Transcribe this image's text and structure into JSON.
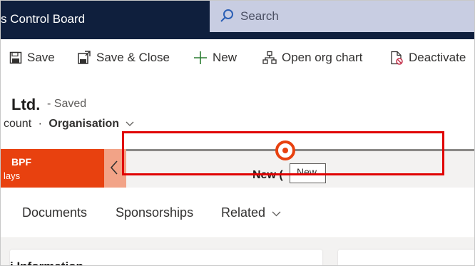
{
  "app": {
    "title": "s Control Board"
  },
  "search": {
    "placeholder": "Search"
  },
  "commands": [
    {
      "label": "Save",
      "icon": "save-icon"
    },
    {
      "label": "Save & Close",
      "icon": "save-close-icon"
    },
    {
      "label": "New",
      "icon": "plus-icon"
    },
    {
      "label": "Open org chart",
      "icon": "org-chart-icon"
    },
    {
      "label": "Deactivate",
      "icon": "deactivate-icon"
    }
  ],
  "record": {
    "name": "Ltd.",
    "saved": "- Saved",
    "entity": "count",
    "separator": "·",
    "form": "Organisation"
  },
  "process": {
    "active_stage": "BPF",
    "duration": "lays",
    "stage_label": "New",
    "stage_label_suffix": "(",
    "tooltip": "New"
  },
  "tabs": [
    "Documents",
    "Sponsorships",
    "Related"
  ],
  "section": {
    "title": "i Information"
  },
  "colors": {
    "nav_bg": "#0f1f3d",
    "search_bg": "#c8cde2",
    "accent": "#e8410f",
    "highlight_box": "#e00000"
  }
}
